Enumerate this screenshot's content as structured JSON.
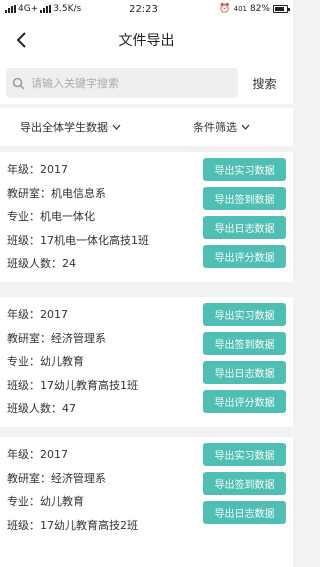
{
  "status_bar": {
    "network": "4G+",
    "speed": "3.5K/s",
    "time": "22:23",
    "signal_badge": "401",
    "battery": "82%",
    "battery_level": 0.82
  },
  "nav": {
    "title": "文件导出"
  },
  "search": {
    "placeholder": "请输入关键字搜索",
    "button": "搜索"
  },
  "filters": {
    "export_all": "导出全体学生数据",
    "condition": "条件筛选"
  },
  "labels": {
    "grade": "年级：",
    "room": "教研室：",
    "major": "专业：",
    "class": "班级：",
    "count": "班级人数："
  },
  "buttons": {
    "internship": "导出实习数据",
    "signin": "导出签到数据",
    "log": "导出日志数据",
    "score": "导出评分数据"
  },
  "cards": [
    {
      "grade": "2017",
      "room": "机电信息系",
      "major": "机电一体化",
      "class": "17机电一体化高技1班",
      "count": "24"
    },
    {
      "grade": "2017",
      "room": "经济管理系",
      "major": "幼儿教育",
      "class": "17幼儿教育高技1班",
      "count": "47"
    },
    {
      "grade": "2017",
      "room": "经济管理系",
      "major": "幼儿教育",
      "class": "17幼儿教育高技2班",
      "count": ""
    }
  ]
}
